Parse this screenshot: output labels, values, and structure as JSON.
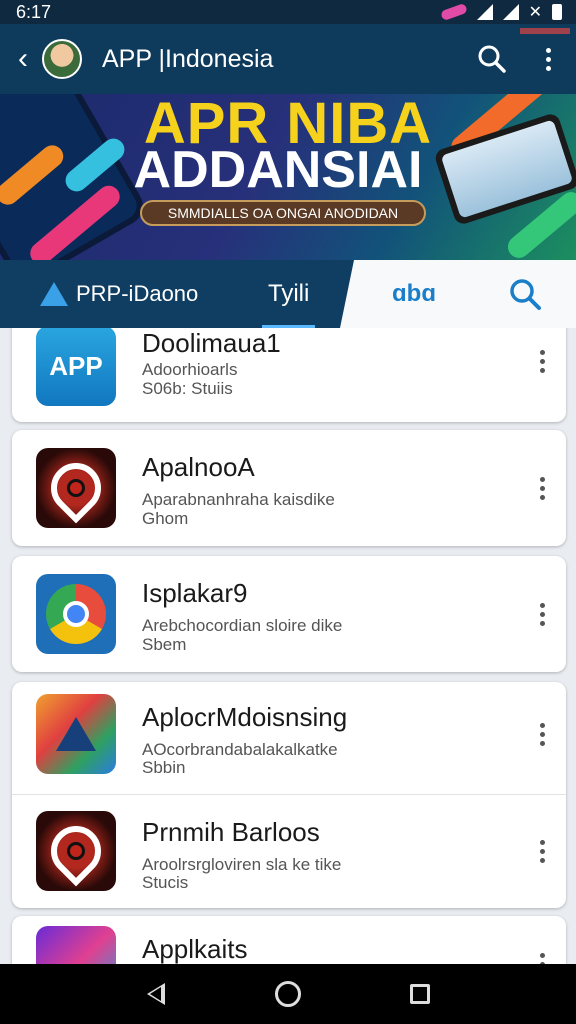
{
  "status": {
    "time": "6:17"
  },
  "app_bar": {
    "title": "APP |Indonesia",
    "back_icon": "chevron-left-icon",
    "search_icon": "search-icon",
    "menu_icon": "more-vert-icon"
  },
  "banner": {
    "line1": "APR NIBA",
    "line2": "ADDANSIAI",
    "cta": "SMMDIALLS OA ONGAI ANODIDAN"
  },
  "tabs": [
    {
      "label": "PRP-iDaono",
      "icon": "brand-a-icon"
    },
    {
      "label": "Tyili",
      "active": true
    },
    {
      "label": "ɑbɑ"
    },
    {
      "label": "",
      "icon": "search-icon"
    }
  ],
  "apps": [
    {
      "title": "Doolimaua1",
      "line1": "Adoorhioarls",
      "line2": "S06b: Stuiis",
      "icon": "app-icon",
      "icon_text": "APP"
    },
    {
      "title": "ApalnooA",
      "line1": "Aparabnanhraha kaisdike",
      "line2": "Ghom",
      "icon": "eye-icon"
    },
    {
      "title": "Isplakar9",
      "line1": "Arebchocordian sloire dike",
      "line2": "Sbem",
      "icon": "chrome-icon"
    },
    {
      "title": "AplocrMdoisnsing",
      "line1": "AOcorbrandabalakalkatke",
      "line2": "Sbbin",
      "icon": "drive-icon"
    },
    {
      "title": "Prnmih Barloos",
      "line1": "Aroolrsrgloviren sla ke tike",
      "line2": "Stucis",
      "icon": "eye-icon"
    },
    {
      "title": "Applkaits",
      "line1": "",
      "line2": "",
      "icon": "app-gradient-icon"
    }
  ],
  "nav": {
    "back_icon": "back-triangle-icon",
    "home_icon": "home-circle-icon",
    "recent_icon": "recents-square-icon"
  }
}
